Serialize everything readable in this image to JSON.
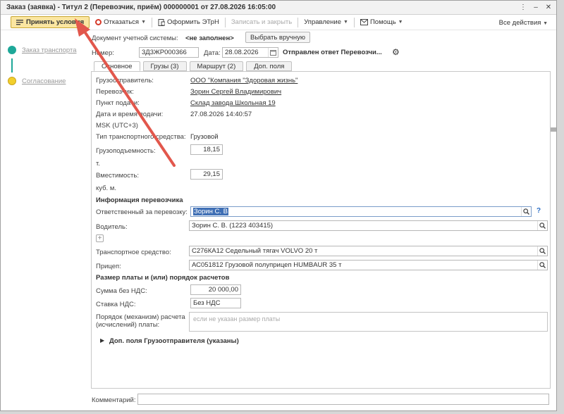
{
  "window": {
    "title": "Заказ (заявка) - Титул 2 (Перевозчик, приём) 000000001 от 27.08.2026 16:05:00",
    "more": "⋮",
    "minimize": "–",
    "close": "✕"
  },
  "toolbar": {
    "accept": "Принять условия",
    "refuse": "Отказаться",
    "issue_etrn": "Оформить ЭТрН",
    "save_close": "Записать и закрыть",
    "manage": "Управление",
    "help": "Помощь",
    "all_actions": "Все действия"
  },
  "steps": [
    {
      "label": "Заказ транспорта",
      "color": "#1ea899"
    },
    {
      "label": "Согласование",
      "color": "#f2cf2c"
    }
  ],
  "doc_system": {
    "label": "Документ учетной системы:",
    "value": "<не заполнен>",
    "button": "Выбрать вручную"
  },
  "header": {
    "number_label": "Номер:",
    "number_value": "3Д3ЖР000366",
    "date_label": "Дата:",
    "date_value": "28.08.2026",
    "status": "Отправлен ответ Перевозчи..."
  },
  "tabs": [
    "Основное",
    "Грузы (3)",
    "Маршрут (2)",
    "Доп. поля"
  ],
  "main": {
    "shipper_label": "Грузоотправитель:",
    "shipper_value": "ООО \"Компания \"Здоровая жизнь\"",
    "carrier_label": "Перевозчик:",
    "carrier_value": "Зорин Сергей Владимирович",
    "pickup_label": "Пункт подачи:",
    "pickup_value": "Склад завода Школьная 19",
    "datetime_label": "Дата и время подачи:",
    "datetime_value": "27.08.2026 14:40:57",
    "timezone": "MSK (UTC+3)",
    "vehicle_type_label": "Тип транспортного средства:",
    "vehicle_type_value": "Грузовой",
    "capacity_label": "Грузоподъемность:",
    "capacity_value": "18,15",
    "capacity_unit": "т.",
    "volume_label": "Вместимость:",
    "volume_value": "29,15",
    "volume_unit": "куб. м."
  },
  "carrier_info": {
    "title": "Информация перевозчика",
    "responsible_label": "Ответственный за перевозку:",
    "responsible_value": "Зорин С. В",
    "help": "?",
    "driver_label": "Водитель:",
    "driver_value": "Зорин С. В. (1223 403415)",
    "add": "+",
    "vehicle_label": "Транспортное средство:",
    "vehicle_value": "С276КА12 Седельный тягач VOLVO 20 т",
    "trailer_label": "Прицеп:",
    "trailer_value": "АС051812 Грузовой полуприцеп HUMBAUR 35 т"
  },
  "payment": {
    "title": "Размер платы и (или) порядок расчетов",
    "sum_label": "Сумма без НДС:",
    "sum_value": "20 000,00",
    "vat_label": "Ставка НДС:",
    "vat_value": "Без НДС",
    "order_label_1": "Порядок (механизм) расчета",
    "order_label_2": "(исчислений) платы:",
    "order_placeholder": "если не указан размер платы"
  },
  "extra": {
    "title": "Доп. поля Грузоотправителя (указаны)"
  },
  "comment": {
    "label": "Комментарий:"
  }
}
